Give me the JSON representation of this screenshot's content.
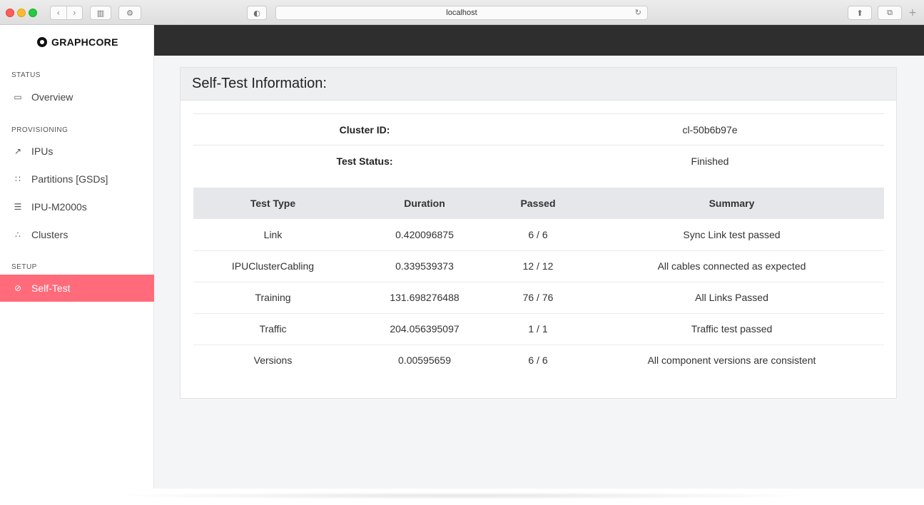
{
  "browser": {
    "url": "localhost",
    "back_icon": "chevron-left-icon",
    "forward_icon": "chevron-right-icon"
  },
  "sidebar": {
    "logo": "GRAPHCORE",
    "sections": {
      "status": "STATUS",
      "provisioning": "PROVISIONING",
      "setup": "SETUP"
    },
    "items": [
      {
        "label": "Overview",
        "icon": "monitor-icon"
      },
      {
        "label": "IPUs",
        "icon": "chart-icon"
      },
      {
        "label": "Partitions [GSDs]",
        "icon": "partition-icon"
      },
      {
        "label": "IPU-M2000s",
        "icon": "server-icon"
      },
      {
        "label": "Clusters",
        "icon": "cluster-icon"
      },
      {
        "label": "Self-Test",
        "icon": "check-circle-icon",
        "active": true
      }
    ]
  },
  "colors": {
    "active_nav": "#ff6b7a",
    "topbar": "#2e2e2e"
  },
  "card": {
    "title": "Self-Test Information:",
    "info": [
      {
        "key": "Cluster ID:",
        "value": "cl-50b6b97e"
      },
      {
        "key": "Test Status:",
        "value": "Finished"
      }
    ],
    "table": {
      "headers": [
        "Test Type",
        "Duration",
        "Passed",
        "Summary"
      ],
      "rows": [
        [
          "Link",
          "0.420096875",
          "6 / 6",
          "Sync Link test passed"
        ],
        [
          "IPUClusterCabling",
          "0.339539373",
          "12 / 12",
          "All cables connected as expected"
        ],
        [
          "Training",
          "131.698276488",
          "76 / 76",
          "All Links Passed"
        ],
        [
          "Traffic",
          "204.056395097",
          "1 / 1",
          "Traffic test passed"
        ],
        [
          "Versions",
          "0.00595659",
          "6 / 6",
          "All component versions are consistent"
        ]
      ]
    }
  }
}
